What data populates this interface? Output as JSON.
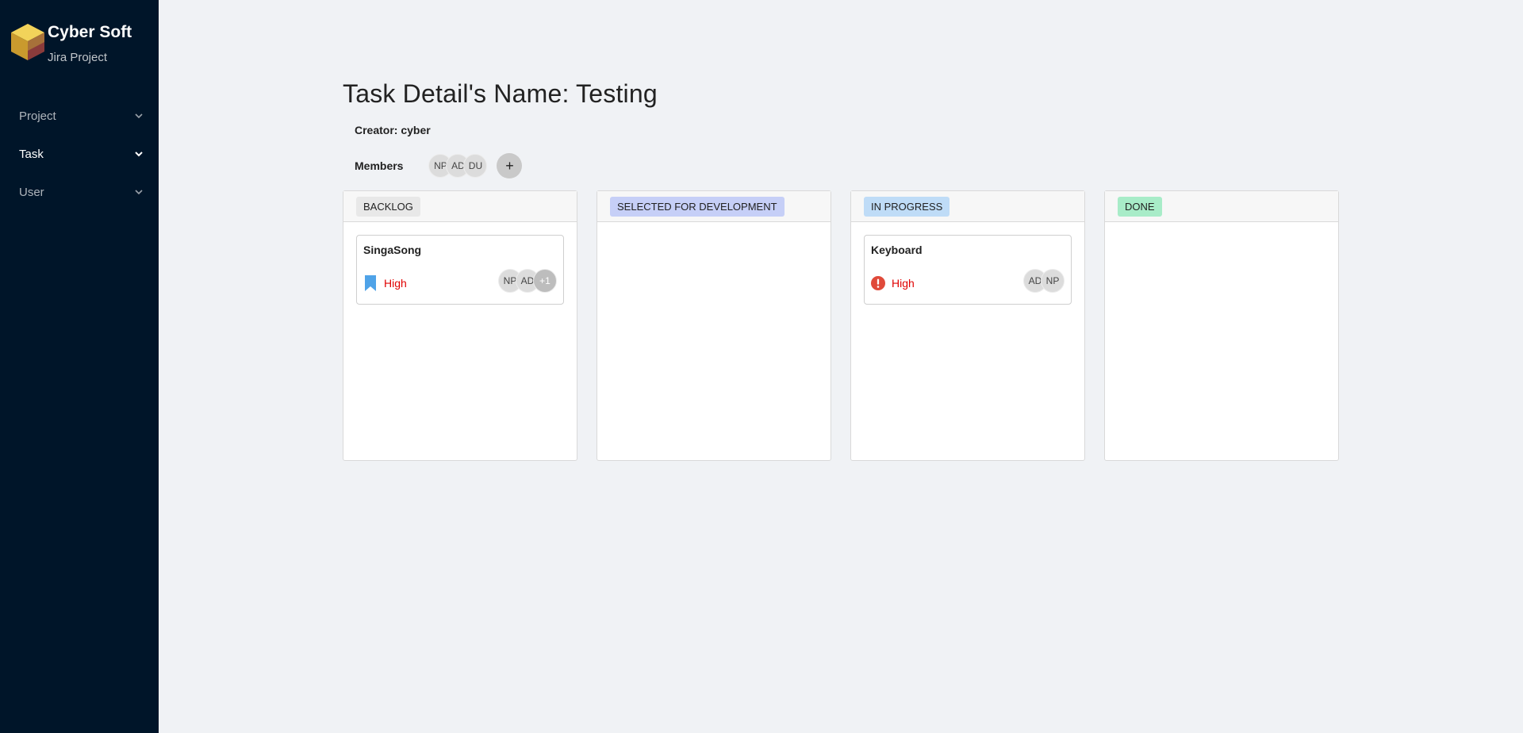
{
  "brand": {
    "name": "Cyber Soft",
    "subtitle": "Jira Project"
  },
  "menu": [
    {
      "label": "Project",
      "active": false
    },
    {
      "label": "Task",
      "active": true
    },
    {
      "label": "User",
      "active": false
    }
  ],
  "page": {
    "title": "Task Detail's Name: Testing",
    "creator": "Creator: cyber",
    "members_label": "Members",
    "members": [
      "NP",
      "AD",
      "DU"
    ],
    "add_member": "+"
  },
  "columns": [
    {
      "title": "BACKLOG",
      "tag_color": "#e8e8e8",
      "tasks": [
        {
          "name": "SingaSong",
          "priority": "High",
          "priority_icon": "bookmark-icon",
          "assignees": [
            "NP",
            "AD"
          ],
          "more": "+1"
        }
      ]
    },
    {
      "title": "SELECTED FOR DEVELOPMENT",
      "tag_color": "#c6cff7",
      "tasks": []
    },
    {
      "title": "IN PROGRESS",
      "tag_color": "#bfdcf7",
      "tasks": [
        {
          "name": "Keyboard",
          "priority": "High",
          "priority_icon": "alert-circle-icon",
          "assignees": [
            "AD",
            "NP"
          ],
          "more": ""
        }
      ]
    },
    {
      "title": "DONE",
      "tag_color": "#a8ecc8",
      "tasks": []
    }
  ],
  "colors": {
    "sidebar_bg": "#001529",
    "page_bg": "#f0f2f5",
    "priority_high": "#e00000",
    "bookmark_blue": "#4fa3e8",
    "alert_red": "#e04a3a"
  }
}
